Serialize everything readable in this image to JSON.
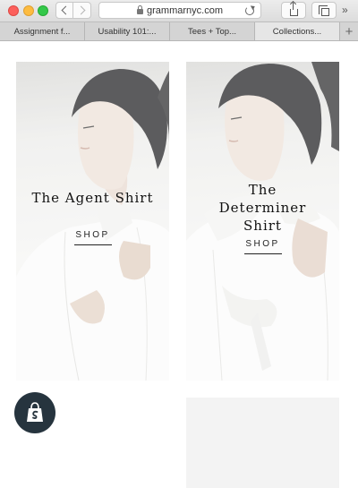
{
  "browser": {
    "url": "grammarnyc.com",
    "tabs": [
      {
        "label": "Assignment f...",
        "active": false
      },
      {
        "label": "Usability 101:...",
        "active": false
      },
      {
        "label": "Tees + Top...",
        "active": false
      },
      {
        "label": "Collections...",
        "active": true
      }
    ],
    "new_tab_label": "+",
    "more_label": "»"
  },
  "products": [
    {
      "title": "The Agent Shirt",
      "cta": "SHOP"
    },
    {
      "title": "The Determiner Shirt",
      "cta": "SHOP"
    }
  ],
  "colors": {
    "traffic_red": "#fc605c",
    "traffic_yellow": "#fdbc40",
    "traffic_green": "#34c84a",
    "shopify_badge": "#26343e",
    "shopify_bag": "#95bf47"
  },
  "icons": [
    "lock-icon",
    "reload-icon",
    "share-icon",
    "tabs-icon",
    "shopify-bag-icon"
  ]
}
